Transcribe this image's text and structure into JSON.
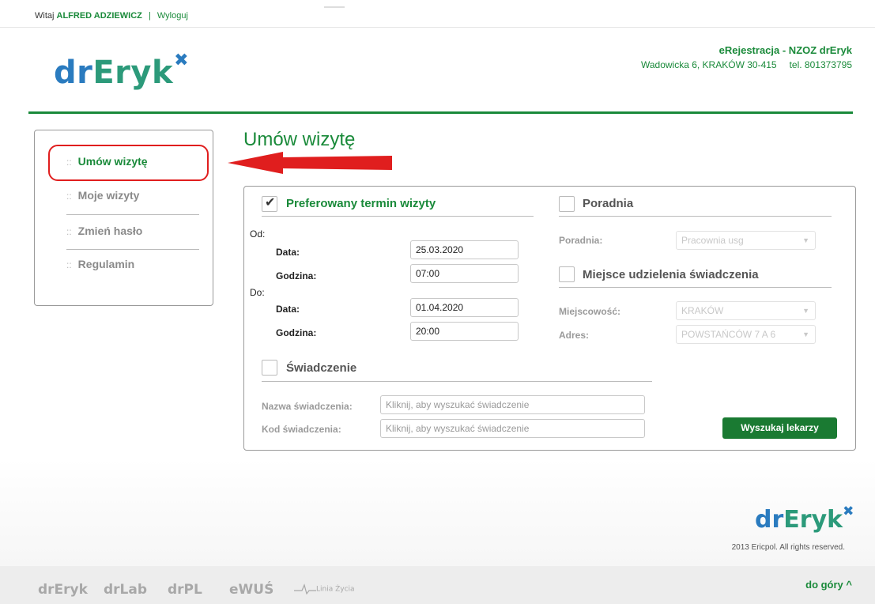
{
  "header": {
    "greeting": "Witaj",
    "user_name": "ALFRED ADZIEWICZ",
    "separator": "|",
    "logout": "Wyloguj",
    "logo": {
      "dr": "dr",
      "eryk": "Eryk",
      "x": "✖"
    },
    "clinic_title": "eRejestracja - NZOZ drEryk",
    "clinic_address": "Wadowicka 6, KRAKÓW 30-415",
    "clinic_phone": "tel. 801373795"
  },
  "sidebar": {
    "items": [
      {
        "label": "Umów wizytę",
        "dots": "::"
      },
      {
        "label": "Moje wizyty",
        "dots": "::"
      },
      {
        "label": "Zmień hasło",
        "dots": "::"
      },
      {
        "label": "Regulamin",
        "dots": "::"
      }
    ]
  },
  "main": {
    "title": "Umów wizytę",
    "preferred": {
      "title": "Preferowany termin wizyty",
      "checked": true,
      "from_label": "Od:",
      "to_label": "Do:",
      "date_label": "Data:",
      "time_label": "Godzina:",
      "from_date": "25.03.2020",
      "from_time": "07:00",
      "to_date": "01.04.2020",
      "to_time": "20:00"
    },
    "clinic": {
      "title": "Poradnia",
      "label": "Poradnia:",
      "value": "Pracownia usg"
    },
    "place": {
      "title": "Miejsce udzielenia świadczenia",
      "city_label": "Miejscowość:",
      "city_value": "KRAKÓW",
      "address_label": "Adres:",
      "address_value": "POWSTAŃCÓW 7 A 6"
    },
    "service": {
      "title": "Świadczenie",
      "name_label": "Nazwa świadczenia:",
      "name_placeholder": "Kliknij, aby wyszukać świadczenie",
      "code_label": "Kod świadczenia:",
      "code_placeholder": "Kliknij, aby wyszukać świadczenie"
    },
    "search_button": "Wyszukaj lekarzy"
  },
  "footer": {
    "logo": {
      "dr": "dr",
      "eryk": "Eryk",
      "x": "✖"
    },
    "copyright": "2013 Ericpol. All rights reserved.",
    "brands": [
      "drEryk",
      "drLab",
      "drPL",
      "eWUŚ",
      "Linia Życia"
    ],
    "to_top": "do góry ^"
  },
  "colors": {
    "green": "#1a8a3a",
    "blue": "#2a7bbf",
    "highlight": "#e01e1e"
  }
}
